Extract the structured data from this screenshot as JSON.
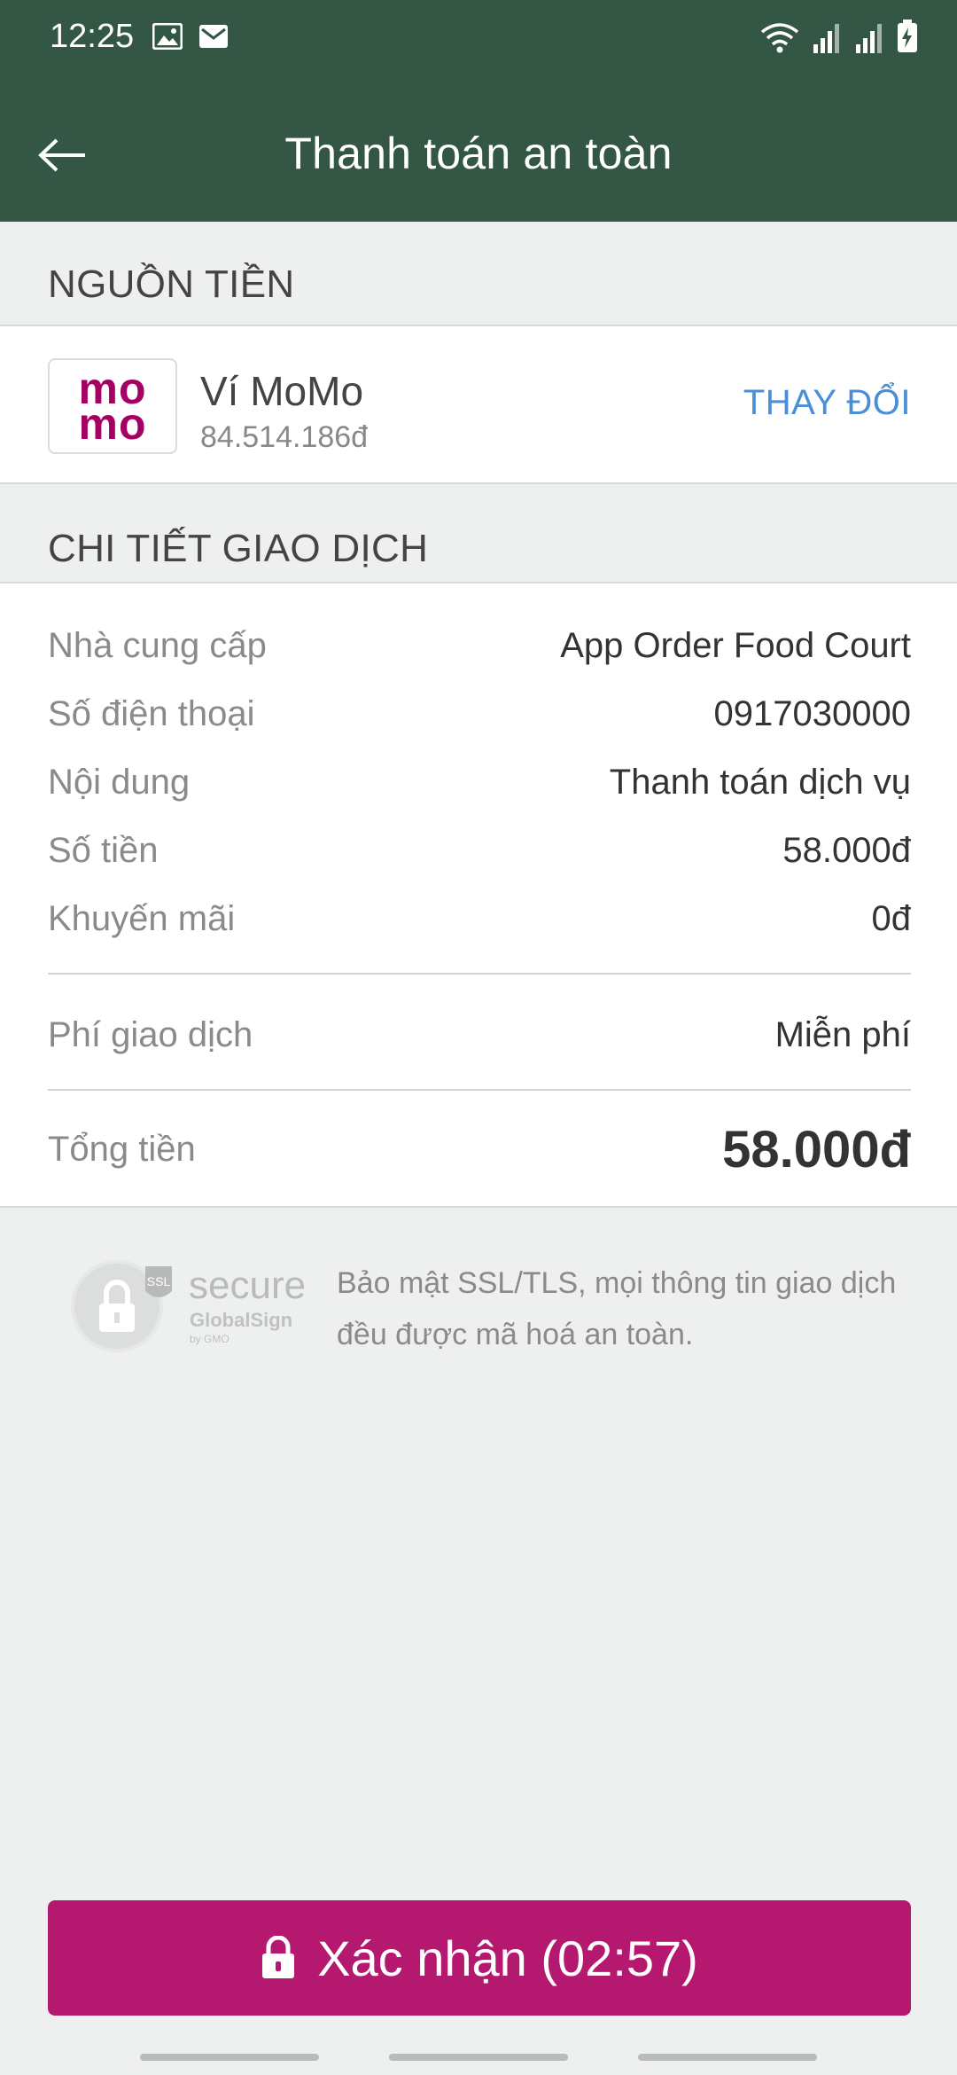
{
  "status_bar": {
    "time": "12:25",
    "left_icons": [
      "image-icon",
      "mail-icon"
    ],
    "right_icons": [
      "wifi-icon",
      "signal-icon",
      "signal-icon",
      "battery-charging-icon"
    ]
  },
  "header": {
    "title": "Thanh toán an toàn",
    "back_icon": "arrow-left-icon"
  },
  "funding_source": {
    "section_label": "NGUỒN TIỀN",
    "logo_text_top": "mo",
    "logo_text_bottom": "mo",
    "name": "Ví MoMo",
    "balance": "84.514.186đ",
    "change_label": "THAY ĐỔI"
  },
  "transaction": {
    "section_label": "CHI TIẾT GIAO DỊCH",
    "rows": [
      {
        "label": "Nhà cung cấp",
        "value": "App Order Food Court"
      },
      {
        "label": "Số điện thoại",
        "value": "0917030000"
      },
      {
        "label": "Nội dung",
        "value": "Thanh toán dịch vụ"
      },
      {
        "label": "Số tiền",
        "value": "58.000đ"
      },
      {
        "label": "Khuyến mãi",
        "value": "0đ"
      }
    ],
    "fee": {
      "label": "Phí giao dịch",
      "value": "Miễn phí"
    },
    "total": {
      "label": "Tổng tiền",
      "value": "58.000đ"
    }
  },
  "security": {
    "badge_text": "secure",
    "badge_ssl": "SSL",
    "badge_brand": "GlobalSign",
    "badge_sub": "by GMO",
    "note": "Bảo mật SSL/TLS, mọi thông tin giao dịch đều được mã hoá an toàn."
  },
  "confirm": {
    "label": "Xác nhận (02:57)",
    "icon": "lock-icon"
  },
  "colors": {
    "header_bg": "#335744",
    "momo_brand": "#a50064",
    "confirm_bg": "#b5196f",
    "link": "#4a8fd6"
  }
}
